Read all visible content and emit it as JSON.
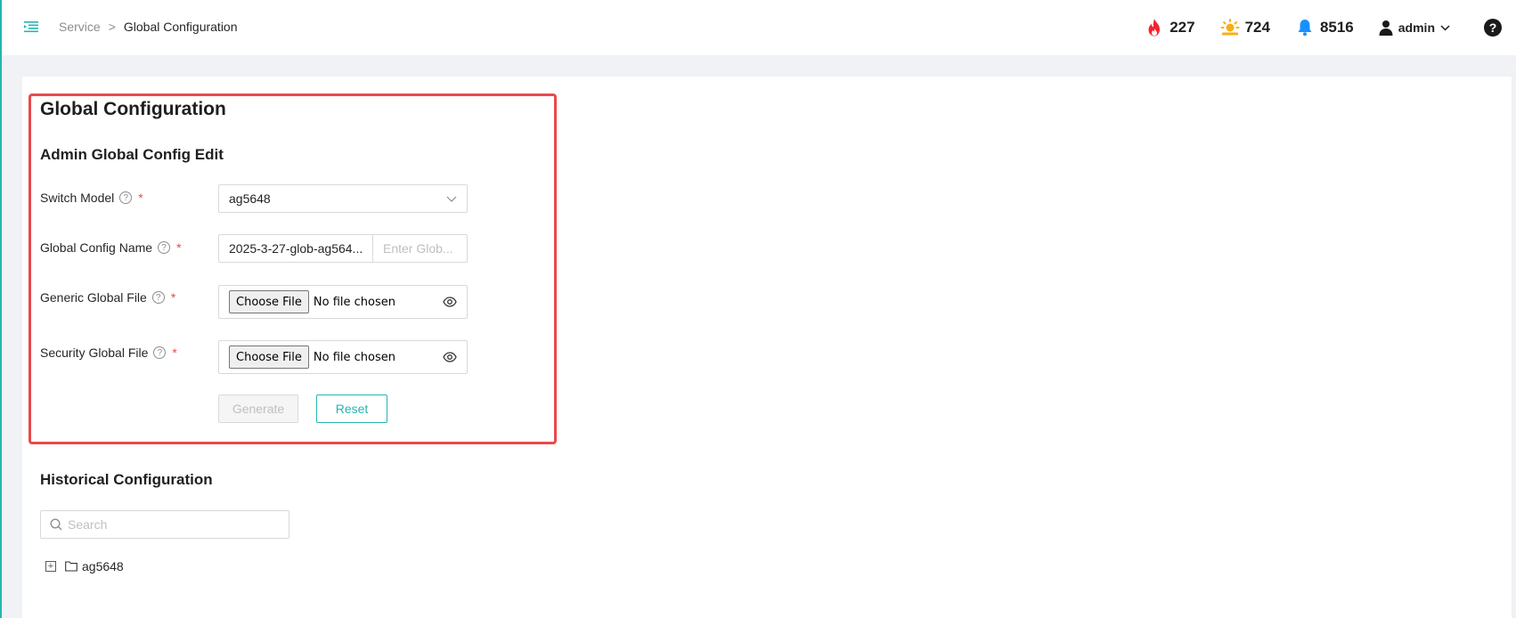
{
  "header": {
    "breadcrumb": {
      "parent": "Service",
      "separator": ">",
      "current": "Global Configuration"
    },
    "stats": [
      {
        "icon": "fire-icon",
        "value": "227",
        "color": "#f5222d"
      },
      {
        "icon": "sun-warning-icon",
        "value": "724",
        "color": "#faad14"
      },
      {
        "icon": "bell-icon",
        "value": "8516",
        "color": "#1890ff"
      }
    ],
    "user": {
      "name": "admin"
    },
    "help_label": "?"
  },
  "page": {
    "title": "Global Configuration",
    "section_title": "Admin Global Config Edit"
  },
  "form": {
    "switch_model": {
      "label": "Switch Model",
      "value": "ag5648"
    },
    "config_name": {
      "label": "Global Config Name",
      "value": "2025-3-27-glob-ag564...",
      "placeholder": "Enter Glob..."
    },
    "generic_file": {
      "label": "Generic Global File",
      "button": "Choose File",
      "status": "No file chosen"
    },
    "security_file": {
      "label": "Security Global File",
      "button": "Choose File",
      "status": "No file chosen"
    },
    "required_mark": "*",
    "generate_label": "Generate",
    "reset_label": "Reset"
  },
  "history": {
    "title": "Historical Configuration",
    "search_placeholder": "Search",
    "tree": [
      {
        "label": "ag5648",
        "expander": "+"
      }
    ]
  },
  "colors": {
    "accent": "#26b5b0",
    "highlight": "#e94a4a"
  }
}
